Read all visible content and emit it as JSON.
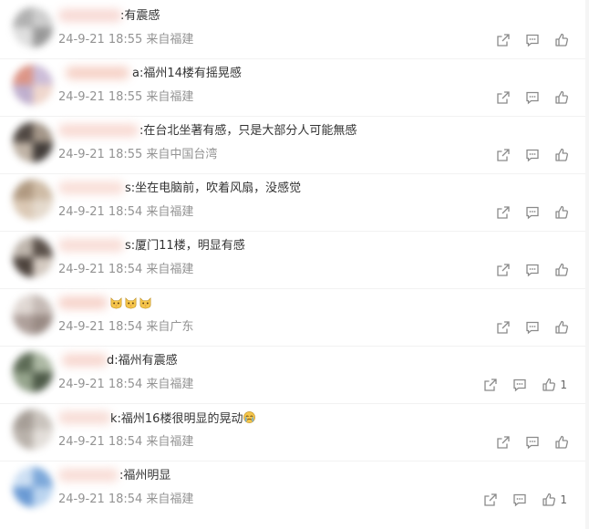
{
  "comments": [
    {
      "content": ":有震感",
      "date": "24-9-21 18:55",
      "source": "来自福建",
      "likes": ""
    },
    {
      "content": "a:福州14楼有摇晃感",
      "date": "24-9-21 18:55",
      "source": "来自福建",
      "likes": ""
    },
    {
      "content": ":在台北坐著有感，只是大部分人可能無感",
      "date": "24-9-21 18:55",
      "source": "来自中国台湾",
      "likes": ""
    },
    {
      "content": "s:坐在电脑前，吹着风扇，没感觉",
      "date": "24-9-21 18:54",
      "source": "来自福建",
      "likes": ""
    },
    {
      "content": "s:厦门11楼，明显有感",
      "date": "24-9-21 18:54",
      "source": "来自福建",
      "likes": ""
    },
    {
      "content": "",
      "date": "24-9-21 18:54",
      "source": "来自广东",
      "likes": ""
    },
    {
      "content": "d:福州有震感",
      "date": "24-9-21 18:54",
      "source": "来自福建",
      "likes": "1"
    },
    {
      "content": "k:福州16楼很明显的晃动",
      "date": "24-9-21 18:54",
      "source": "来自福建",
      "likes": ""
    },
    {
      "content": ":福州明显",
      "date": "24-9-21 18:54",
      "source": "来自福建",
      "likes": "1"
    }
  ],
  "icons": {
    "share": "share-icon",
    "comment": "comment-icon",
    "like": "thumbs-up-icon",
    "emoji_cat": "cat-face-emoji",
    "emoji_cry": "crying-face-emoji"
  },
  "colors": {
    "text": "#333333",
    "meta": "#939393",
    "icon": "#8a8a8a",
    "background": "#ffffff"
  }
}
